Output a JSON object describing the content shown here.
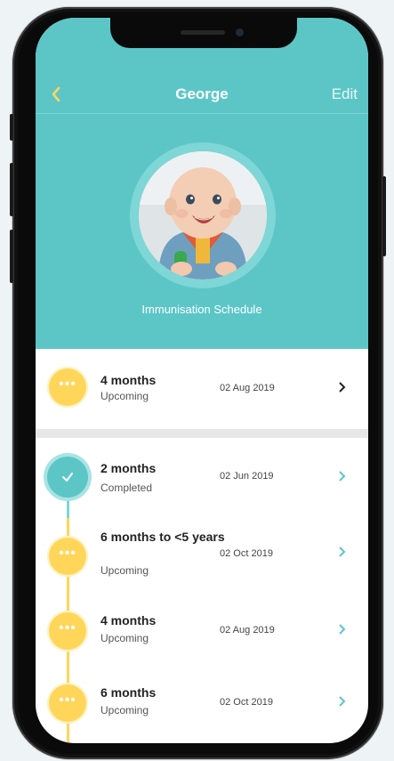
{
  "header": {
    "title": "George",
    "edit_label": "Edit",
    "subtitle": "Immunisation Schedule",
    "background": "#5cc6c7"
  },
  "upcoming_top": {
    "name": "4 months",
    "status": "Upcoming",
    "date": "02 Aug 2019"
  },
  "schedule": [
    {
      "name": "2 months",
      "status": "Completed",
      "date": "02 Jun 2019",
      "state": "completed"
    },
    {
      "name": "6 months to <5 years",
      "status": "Upcoming",
      "date": "02 Oct 2019",
      "state": "upcoming"
    },
    {
      "name": "4 months",
      "status": "Upcoming",
      "date": "02 Aug 2019",
      "state": "upcoming"
    },
    {
      "name": "6 months",
      "status": "Upcoming",
      "date": "02 Oct 2019",
      "state": "upcoming"
    }
  ],
  "colors": {
    "accent_teal": "#5cc6c7",
    "upcoming_yellow": "#ffd65a",
    "back_arrow": "#ffd65a"
  },
  "icons": {
    "back": "chevron-left-icon",
    "row_chevron": "chevron-right-icon",
    "pending": "ellipsis-icon",
    "completed": "checkmark-icon"
  }
}
